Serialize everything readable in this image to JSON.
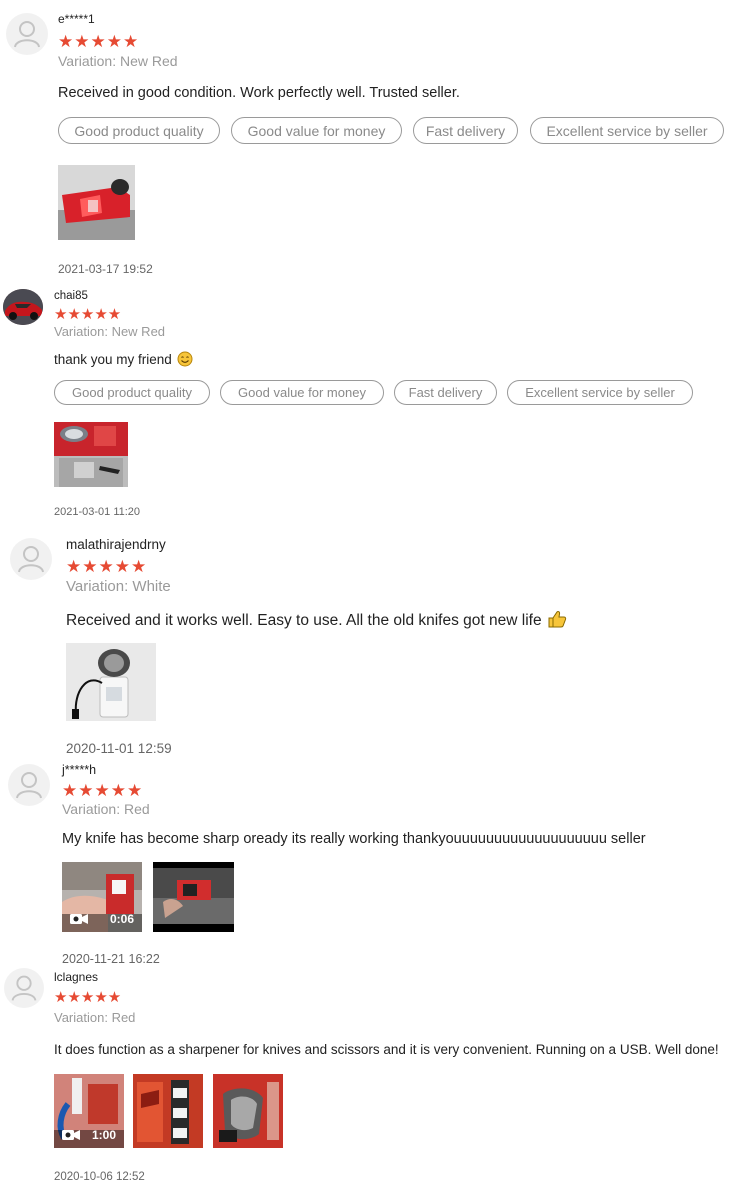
{
  "reviews": [
    {
      "user": "e*****1",
      "stars": "★★★★★",
      "variation": "Variation: New Red",
      "text": "Received in good condition. Work perfectly well. Trusted seller.",
      "tags": [
        "Good product quality",
        "Good value for money",
        "Fast delivery",
        "Excellent service by seller"
      ],
      "date": "2021-03-17 19:52"
    },
    {
      "user": "chai85",
      "stars": "★★★★★",
      "variation": "Variation: New Red",
      "text": "thank you my friend",
      "emoji": "smiling-face-icon",
      "tags": [
        "Good product quality",
        "Good value for money",
        "Fast delivery",
        "Excellent service by seller"
      ],
      "date": "2021-03-01 11:20"
    },
    {
      "user": "malathirajendrny",
      "stars": "★★★★★",
      "variation": "Variation: White",
      "text": "Received and it works well. Easy to use. All the old knifes got new life",
      "emoji": "thumbs-up-icon",
      "date": "2020-11-01 12:59"
    },
    {
      "user": "j*****h",
      "stars": "★★★★★",
      "variation": "Variation: Red",
      "text": "My knife has become sharp oready its really working thankyouuuuuuuuuuuuuuuuuuu seller",
      "video_duration": "0:06",
      "date": "2020-11-21 16:22"
    },
    {
      "user": "lclagnes",
      "stars": "★★★★★",
      "variation": "Variation: Red",
      "text": "It does function as a sharpener for knives and scissors  and it is very convenient. Running on a USB.  Well done!",
      "video_duration": "1:00",
      "date": "2020-10-06 12:52"
    }
  ],
  "colors": {
    "star": "#e64a33",
    "muted": "#9a9a9a",
    "tag_border": "#9a9a9a"
  }
}
